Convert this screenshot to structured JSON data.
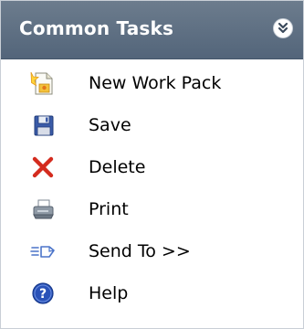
{
  "panel": {
    "title": "Common Tasks",
    "collapse_icon": "double-chevron-down-icon"
  },
  "tasks": [
    {
      "label": "New Work Pack",
      "icon": "new-document-icon"
    },
    {
      "label": "Save",
      "icon": "floppy-disk-icon"
    },
    {
      "label": "Delete",
      "icon": "red-x-icon"
    },
    {
      "label": "Print",
      "icon": "printer-icon"
    },
    {
      "label": "Send To >>",
      "icon": "send-to-icon"
    },
    {
      "label": "Help",
      "icon": "help-icon"
    }
  ],
  "colors": {
    "header_bg": "#5a6b7e",
    "header_text": "#ffffff",
    "delete_red": "#d42b1e",
    "help_blue": "#2a52b8"
  }
}
